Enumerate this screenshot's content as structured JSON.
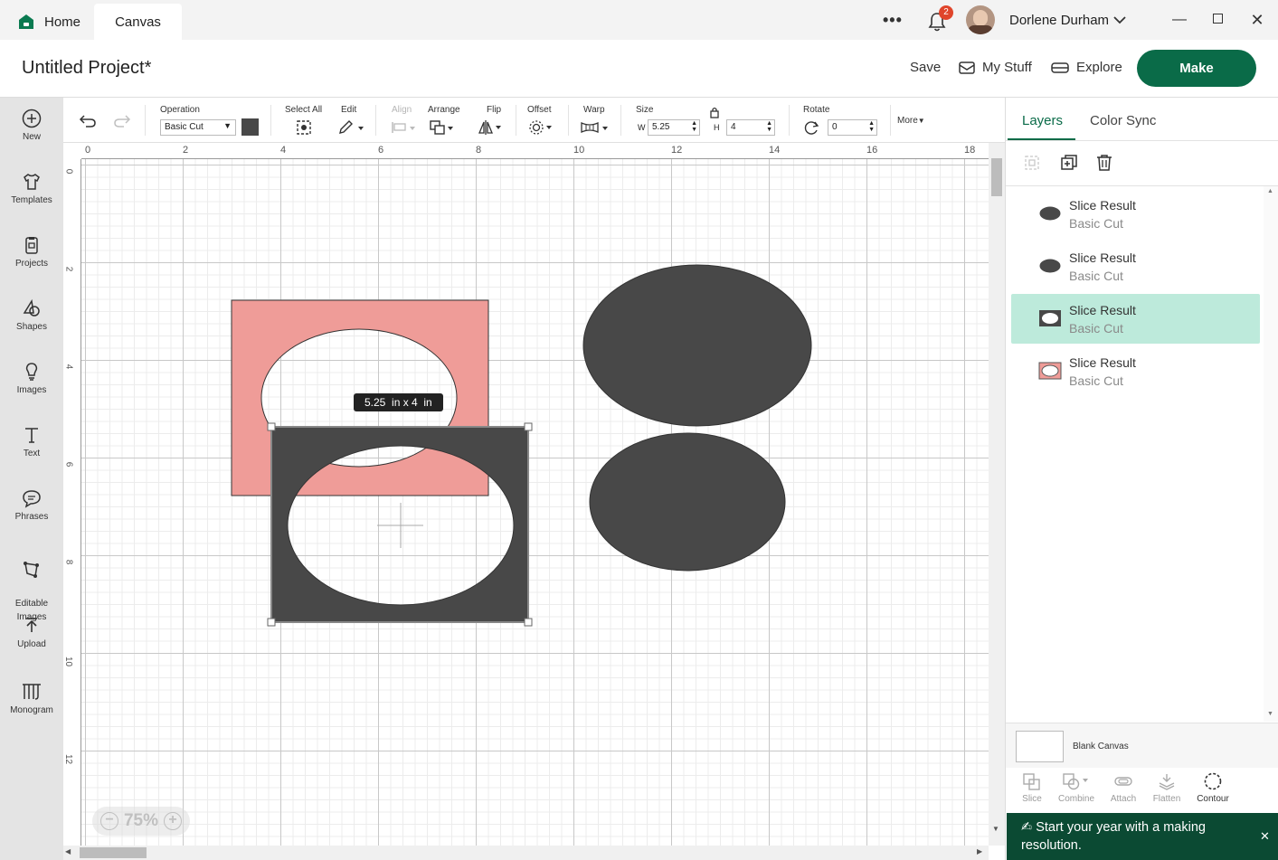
{
  "titlebar": {
    "tabs": [
      {
        "label": "Home"
      },
      {
        "label": "Canvas"
      }
    ],
    "notifications": {
      "count": "2"
    },
    "user": {
      "name": "Dorlene Durham"
    }
  },
  "header": {
    "project_title": "Untitled Project*",
    "save_label": "Save",
    "mystuff_label": "My Stuff",
    "explore_label": "Explore",
    "make_label": "Make",
    "brand_color": "#0a6b48"
  },
  "sidebar": {
    "items": [
      {
        "label": "New",
        "icon": "plus-circle-icon"
      },
      {
        "label": "Templates",
        "icon": "shirt-icon"
      },
      {
        "label": "Projects",
        "icon": "clipboard-icon"
      },
      {
        "label": "Shapes",
        "icon": "shapes-icon"
      },
      {
        "label": "Images",
        "icon": "lightbulb-icon"
      },
      {
        "label": "Text",
        "icon": "text-t-icon"
      },
      {
        "label": "Phrases",
        "icon": "speech-bubble-icon"
      },
      {
        "label": "Editable\nImages",
        "icon": "editable-image-icon"
      },
      {
        "label": "Upload",
        "icon": "upload-icon"
      },
      {
        "label": "Monogram",
        "icon": "monogram-icon"
      }
    ]
  },
  "toolbar": {
    "operation_label": "Operation",
    "operation_value": "Basic Cut",
    "select_all_label": "Select All",
    "edit_label": "Edit",
    "align_label": "Align",
    "arrange_label": "Arrange",
    "flip_label": "Flip",
    "offset_label": "Offset",
    "warp_label": "Warp",
    "size_label": "Size",
    "w_label": "W",
    "w_value": "5.25",
    "h_label": "H",
    "h_value": "4",
    "rotate_label": "Rotate",
    "rotate_value": "0",
    "more_label": "More"
  },
  "canvas": {
    "ruler_top": [
      "0",
      "2",
      "4",
      "6",
      "8",
      "10",
      "12",
      "14",
      "16",
      "18"
    ],
    "ruler_left": [
      "0",
      "2",
      "4",
      "6",
      "8",
      "10",
      "12"
    ],
    "size_tooltip": "5.25  in x 4  in",
    "zoom": "75%",
    "colors": {
      "pink": "#ef9c98",
      "dark": "#484848"
    }
  },
  "panel": {
    "tabs": [
      {
        "label": "Layers"
      },
      {
        "label": "Color Sync"
      }
    ],
    "layers": [
      {
        "title": "Slice Result",
        "subtitle": "Basic Cut",
        "selected": false
      },
      {
        "title": "Slice Result",
        "subtitle": "Basic Cut",
        "selected": false
      },
      {
        "title": "Slice Result",
        "subtitle": "Basic Cut",
        "selected": true
      },
      {
        "title": "Slice Result",
        "subtitle": "Basic Cut",
        "selected": false
      }
    ],
    "blank_canvas_label": "Blank Canvas",
    "bottom_tools": [
      {
        "label": "Slice"
      },
      {
        "label": "Combine"
      },
      {
        "label": "Attach"
      },
      {
        "label": "Flatten"
      },
      {
        "label": "Contour"
      }
    ],
    "promo_text": "Start your year with a making resolution."
  }
}
